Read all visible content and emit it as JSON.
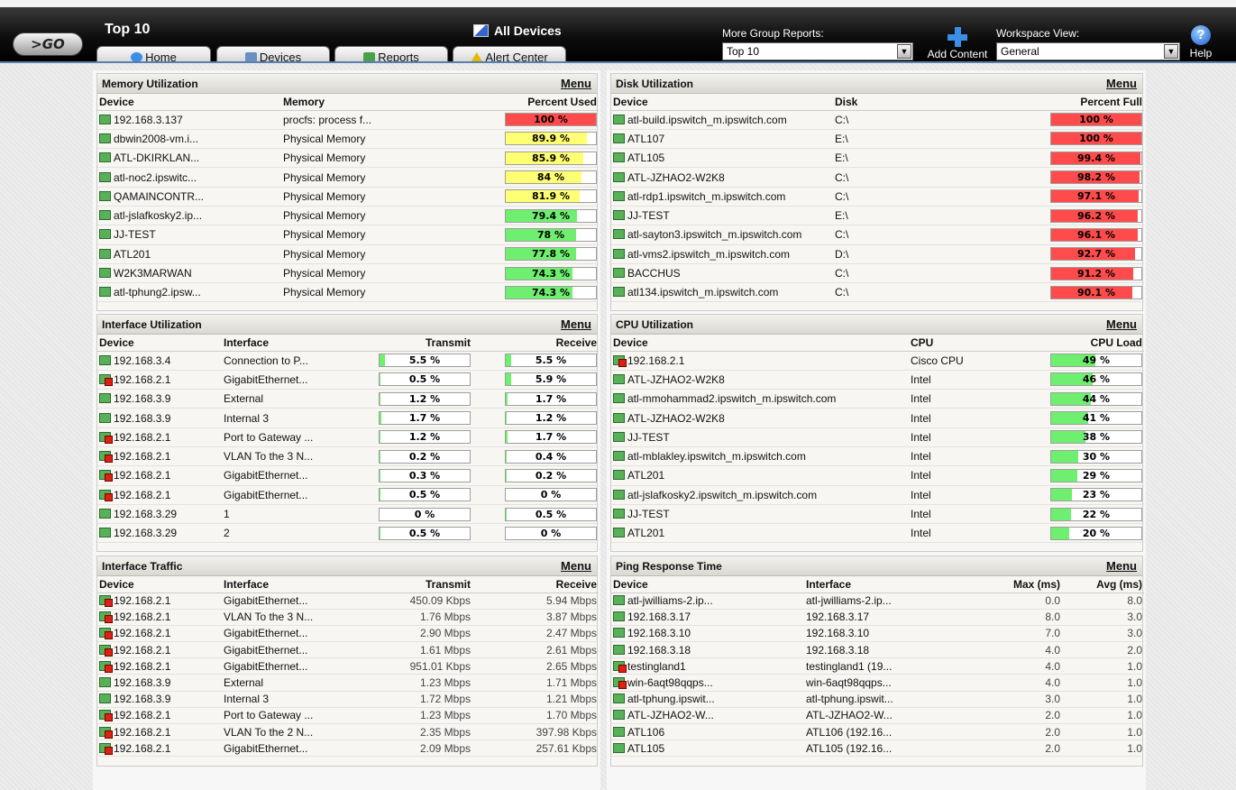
{
  "header": {
    "go_label": ">GO",
    "title": "Top 10",
    "all_devices": "All Devices",
    "more_group_label": "More Group Reports:",
    "group_value": "Top 10",
    "add_content": "Add Content",
    "workspace_label": "Workspace View:",
    "workspace_value": "General",
    "help": "Help"
  },
  "nav": [
    {
      "label": "Home",
      "icon": "home-icon",
      "color": "#3a8ee6"
    },
    {
      "label": "Devices",
      "icon": "devices-icon",
      "color": "#6b8fc0"
    },
    {
      "label": "Reports",
      "icon": "reports-icon",
      "color": "#4aa04a"
    },
    {
      "label": "Alert Center",
      "icon": "alert-icon",
      "color": "#e6b800"
    }
  ],
  "colors": {
    "red": "#ff4b4b",
    "yellow": "#ffff73",
    "green": "#6fef6f"
  },
  "memory": {
    "title": "Memory Utilization",
    "menu": "Menu",
    "headers": [
      "Device",
      "Memory",
      "Percent Used"
    ],
    "rows": [
      {
        "device": "192.168.3.137",
        "alert": false,
        "memory": "procfs: process f...",
        "pct": "100 %",
        "value": 100,
        "color": "red"
      },
      {
        "device": "dbwin2008-vm.i...",
        "alert": false,
        "memory": "Physical Memory",
        "pct": "89.9 %",
        "value": 89.9,
        "color": "yellow"
      },
      {
        "device": "ATL-DKIRKLAN...",
        "alert": false,
        "memory": "Physical Memory",
        "pct": "85.9 %",
        "value": 85.9,
        "color": "yellow"
      },
      {
        "device": "atl-noc2.ipswitc...",
        "alert": false,
        "memory": "Physical Memory",
        "pct": "84 %",
        "value": 84,
        "color": "yellow"
      },
      {
        "device": "QAMAINCONTR...",
        "alert": false,
        "memory": "Physical Memory",
        "pct": "81.9 %",
        "value": 81.9,
        "color": "yellow"
      },
      {
        "device": "atl-jslafkosky2.ip...",
        "alert": false,
        "memory": "Physical Memory",
        "pct": "79.4 %",
        "value": 79.4,
        "color": "green"
      },
      {
        "device": "JJ-TEST",
        "alert": false,
        "memory": "Physical Memory",
        "pct": "78 %",
        "value": 78,
        "color": "green"
      },
      {
        "device": "ATL201",
        "alert": false,
        "memory": "Physical Memory",
        "pct": "77.8 %",
        "value": 77.8,
        "color": "green"
      },
      {
        "device": "W2K3MARWAN",
        "alert": false,
        "memory": "Physical Memory",
        "pct": "74.3 %",
        "value": 74.3,
        "color": "green"
      },
      {
        "device": "atl-tphung2.ipsw...",
        "alert": false,
        "memory": "Physical Memory",
        "pct": "74.3 %",
        "value": 74.3,
        "color": "green"
      }
    ]
  },
  "disk": {
    "title": "Disk Utilization",
    "menu": "Menu",
    "headers": [
      "Device",
      "Disk",
      "Percent Full"
    ],
    "rows": [
      {
        "device": "atl-build.ipswitch_m.ipswitch.com",
        "alert": false,
        "disk": "C:\\",
        "pct": "100 %",
        "value": 100
      },
      {
        "device": "ATL107",
        "alert": false,
        "disk": "E:\\",
        "pct": "100 %",
        "value": 100
      },
      {
        "device": "ATL105",
        "alert": false,
        "disk": "E:\\",
        "pct": "99.4 %",
        "value": 99.4
      },
      {
        "device": "ATL-JZHAO2-W2K8",
        "alert": false,
        "disk": "C:\\",
        "pct": "98.2 %",
        "value": 98.2
      },
      {
        "device": "atl-rdp1.ipswitch_m.ipswitch.com",
        "alert": false,
        "disk": "C:\\",
        "pct": "97.1 %",
        "value": 97.1
      },
      {
        "device": "JJ-TEST",
        "alert": false,
        "disk": "E:\\",
        "pct": "96.2 %",
        "value": 96.2
      },
      {
        "device": "atl-sayton3.ipswitch_m.ipswitch.com",
        "alert": false,
        "disk": "C:\\",
        "pct": "96.1 %",
        "value": 96.1
      },
      {
        "device": "atl-vms2.ipswitch_m.ipswitch.com",
        "alert": false,
        "disk": "D:\\",
        "pct": "92.7 %",
        "value": 92.7
      },
      {
        "device": "BACCHUS",
        "alert": false,
        "disk": "C:\\",
        "pct": "91.2 %",
        "value": 91.2
      },
      {
        "device": "atl134.ipswitch_m.ipswitch.com",
        "alert": false,
        "disk": "C:\\",
        "pct": "90.1 %",
        "value": 90.1
      }
    ]
  },
  "iface_util": {
    "title": "Interface Utilization",
    "menu": "Menu",
    "headers": [
      "Device",
      "Interface",
      "Transmit",
      "Receive"
    ],
    "rows": [
      {
        "device": "192.168.3.4",
        "alert": false,
        "iface": "Connection to P...",
        "tx": "5.5 %",
        "txv": 5.5,
        "rx": "5.5 %",
        "rxv": 5.5
      },
      {
        "device": "192.168.2.1",
        "alert": true,
        "iface": "GigabitEthernet...",
        "tx": "0.5 %",
        "txv": 0.5,
        "rx": "5.9 %",
        "rxv": 5.9
      },
      {
        "device": "192.168.3.9",
        "alert": false,
        "iface": "External",
        "tx": "1.2 %",
        "txv": 1.2,
        "rx": "1.7 %",
        "rxv": 1.7
      },
      {
        "device": "192.168.3.9",
        "alert": false,
        "iface": "Internal 3",
        "tx": "1.7 %",
        "txv": 1.7,
        "rx": "1.2 %",
        "rxv": 1.2
      },
      {
        "device": "192.168.2.1",
        "alert": true,
        "iface": "Port to Gateway ...",
        "tx": "1.2 %",
        "txv": 1.2,
        "rx": "1.7 %",
        "rxv": 1.7
      },
      {
        "device": "192.168.2.1",
        "alert": true,
        "iface": "VLAN To the 3 N...",
        "tx": "0.2 %",
        "txv": 0.2,
        "rx": "0.4 %",
        "rxv": 0.4
      },
      {
        "device": "192.168.2.1",
        "alert": true,
        "iface": "GigabitEthernet...",
        "tx": "0.3 %",
        "txv": 0.3,
        "rx": "0.2 %",
        "rxv": 0.2
      },
      {
        "device": "192.168.2.1",
        "alert": true,
        "iface": "GigabitEthernet...",
        "tx": "0.5 %",
        "txv": 0.5,
        "rx": "0 %",
        "rxv": 0
      },
      {
        "device": "192.168.3.29",
        "alert": false,
        "iface": "1",
        "tx": "0 %",
        "txv": 0,
        "rx": "0.5 %",
        "rxv": 0.5
      },
      {
        "device": "192.168.3.29",
        "alert": false,
        "iface": "2",
        "tx": "0.5 %",
        "txv": 0.5,
        "rx": "0 %",
        "rxv": 0
      }
    ]
  },
  "cpu": {
    "title": "CPU Utilization",
    "menu": "Menu",
    "headers": [
      "Device",
      "CPU",
      "CPU Load"
    ],
    "rows": [
      {
        "device": "192.168.2.1",
        "alert": true,
        "cpu": "Cisco CPU",
        "pct": "49 %",
        "value": 49
      },
      {
        "device": "ATL-JZHAO2-W2K8",
        "alert": false,
        "cpu": "Intel",
        "pct": "46 %",
        "value": 46
      },
      {
        "device": "atl-mmohammad2.ipswitch_m.ipswitch.com",
        "alert": false,
        "cpu": "Intel",
        "pct": "44 %",
        "value": 44
      },
      {
        "device": "ATL-JZHAO2-W2K8",
        "alert": false,
        "cpu": "Intel",
        "pct": "41 %",
        "value": 41
      },
      {
        "device": "JJ-TEST",
        "alert": false,
        "cpu": "Intel",
        "pct": "38 %",
        "value": 38
      },
      {
        "device": "atl-mblakley.ipswitch_m.ipswitch.com",
        "alert": false,
        "cpu": "Intel",
        "pct": "30 %",
        "value": 30
      },
      {
        "device": "ATL201",
        "alert": false,
        "cpu": "Intel",
        "pct": "29 %",
        "value": 29
      },
      {
        "device": "atl-jslafkosky2.ipswitch_m.ipswitch.com",
        "alert": false,
        "cpu": "Intel",
        "pct": "23 %",
        "value": 23
      },
      {
        "device": "JJ-TEST",
        "alert": false,
        "cpu": "Intel",
        "pct": "22 %",
        "value": 22
      },
      {
        "device": "ATL201",
        "alert": false,
        "cpu": "Intel",
        "pct": "20 %",
        "value": 20
      }
    ]
  },
  "traffic": {
    "title": "Interface Traffic",
    "menu": "Menu",
    "headers": [
      "Device",
      "Interface",
      "Transmit",
      "Receive"
    ],
    "rows": [
      {
        "device": "192.168.2.1",
        "alert": true,
        "iface": "GigabitEthernet...",
        "tx": "450.09 Kbps",
        "rx": "5.94 Mbps"
      },
      {
        "device": "192.168.2.1",
        "alert": true,
        "iface": "VLAN To the 3 N...",
        "tx": "1.76 Mbps",
        "rx": "3.87 Mbps"
      },
      {
        "device": "192.168.2.1",
        "alert": true,
        "iface": "GigabitEthernet...",
        "tx": "2.90 Mbps",
        "rx": "2.47 Mbps"
      },
      {
        "device": "192.168.2.1",
        "alert": true,
        "iface": "GigabitEthernet...",
        "tx": "1.61 Mbps",
        "rx": "2.61 Mbps"
      },
      {
        "device": "192.168.2.1",
        "alert": true,
        "iface": "GigabitEthernet...",
        "tx": "951.01 Kbps",
        "rx": "2.65 Mbps"
      },
      {
        "device": "192.168.3.9",
        "alert": false,
        "iface": "External",
        "tx": "1.23 Mbps",
        "rx": "1.71 Mbps"
      },
      {
        "device": "192.168.3.9",
        "alert": false,
        "iface": "Internal 3",
        "tx": "1.72 Mbps",
        "rx": "1.21 Mbps"
      },
      {
        "device": "192.168.2.1",
        "alert": true,
        "iface": "Port to Gateway ...",
        "tx": "1.23 Mbps",
        "rx": "1.70 Mbps"
      },
      {
        "device": "192.168.2.1",
        "alert": true,
        "iface": "VLAN To the 2 N...",
        "tx": "2.35 Mbps",
        "rx": "397.98 Kbps"
      },
      {
        "device": "192.168.2.1",
        "alert": true,
        "iface": "GigabitEthernet...",
        "tx": "2.09 Mbps",
        "rx": "257.61 Kbps"
      }
    ]
  },
  "ping": {
    "title": "Ping Response Time",
    "menu": "Menu",
    "headers": [
      "Device",
      "Interface",
      "Max (ms)",
      "Avg (ms)"
    ],
    "rows": [
      {
        "device": "atl-jwilliams-2.ip...",
        "alert": false,
        "iface": "atl-jwilliams-2.ip...",
        "max": "0.0",
        "avg": "8.0"
      },
      {
        "device": "192.168.3.17",
        "alert": false,
        "iface": "192.168.3.17",
        "max": "8.0",
        "avg": "3.0"
      },
      {
        "device": "192.168.3.10",
        "alert": false,
        "iface": "192.168.3.10",
        "max": "7.0",
        "avg": "3.0"
      },
      {
        "device": "192.168.3.18",
        "alert": false,
        "iface": "192.168.3.18",
        "max": "4.0",
        "avg": "2.0"
      },
      {
        "device": "testingland1",
        "alert": true,
        "iface": "testingland1 (19...",
        "max": "4.0",
        "avg": "1.0"
      },
      {
        "device": "win-6aqt98qqps...",
        "alert": true,
        "iface": "win-6aqt98qqps...",
        "max": "4.0",
        "avg": "1.0"
      },
      {
        "device": "atl-tphung.ipswit...",
        "alert": false,
        "iface": "atl-tphung.ipswit...",
        "max": "3.0",
        "avg": "1.0"
      },
      {
        "device": "ATL-JZHAO2-W...",
        "alert": false,
        "iface": "ATL-JZHAO2-W...",
        "max": "2.0",
        "avg": "1.0"
      },
      {
        "device": "ATL106",
        "alert": false,
        "iface": "ATL106 (192.16...",
        "max": "2.0",
        "avg": "1.0"
      },
      {
        "device": "ATL105",
        "alert": false,
        "iface": "ATL105 (192.16...",
        "max": "2.0",
        "avg": "1.0"
      }
    ]
  }
}
